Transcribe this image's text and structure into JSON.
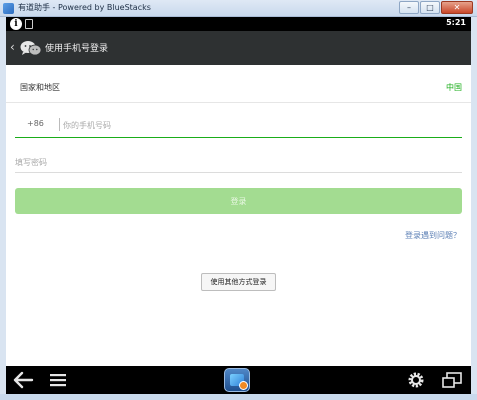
{
  "window": {
    "title": "有道助手 - Powered by BlueStacks",
    "buttons": {
      "minimize": "–",
      "maximize": "□",
      "close": "✕"
    }
  },
  "statusbar": {
    "time": "5:21",
    "info_icon": "info-icon",
    "sd_icon": "sd-card-icon"
  },
  "actionbar": {
    "back_glyph": "‹",
    "icon": "wechat-icon",
    "title": "使用手机号登录"
  },
  "form": {
    "region_label": "国家和地区",
    "region_value": "中国",
    "country_code": "+86",
    "phone_value": "",
    "phone_placeholder": "你的手机号码",
    "password_value": "",
    "password_placeholder": "填写密码",
    "login_label": "登录",
    "trouble_link": "登录遇到问题？",
    "other_login": "使用其他方式登录"
  },
  "navbar": {
    "back_icon": "back-arrow-icon",
    "menu_icon": "menu-icon",
    "app_icon": "bluestacks-app-icon",
    "settings_icon": "gear-icon",
    "window_icon": "window-switch-icon"
  },
  "colors": {
    "accent": "#1aad19",
    "login_button_disabled": "#a3dc91",
    "actionbar": "#2e3132",
    "link": "#5b7fb5"
  }
}
